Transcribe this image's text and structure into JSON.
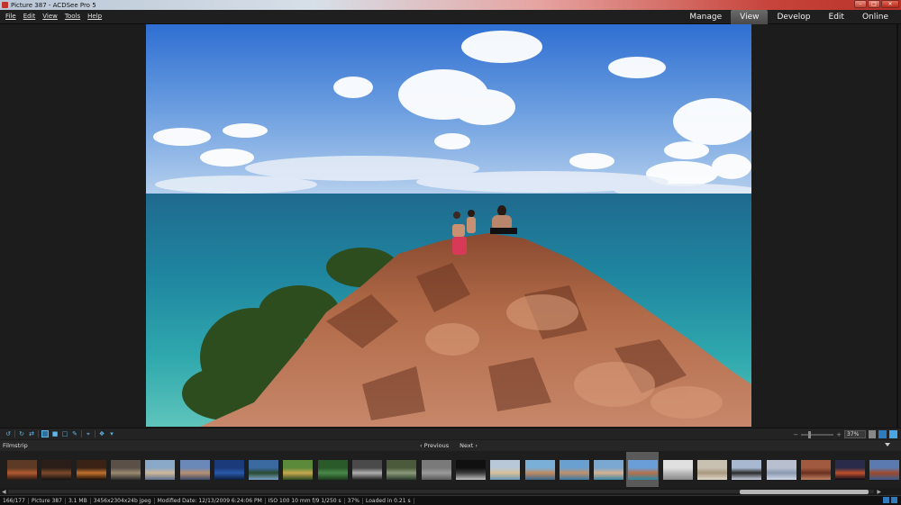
{
  "window": {
    "title": "Picture 387 - ACDSee Pro 5"
  },
  "menu": [
    "File",
    "Edit",
    "View",
    "Tools",
    "Help"
  ],
  "modes": [
    {
      "label": "Manage",
      "active": false
    },
    {
      "label": "View",
      "active": true
    },
    {
      "label": "Develop",
      "active": false
    },
    {
      "label": "Edit",
      "active": false
    },
    {
      "label": "Online",
      "active": false
    }
  ],
  "toolbar": {
    "zoom_value": "37%"
  },
  "filmstrip": {
    "label": "Filmstrip",
    "previous_label": "Previous",
    "next_label": "Next",
    "selected_index": 18,
    "thumbnails": [
      {
        "colors": [
          "#5c3a25",
          "#b25a30",
          "#2a1a12"
        ]
      },
      {
        "colors": [
          "#2b1e18",
          "#7c4a2c",
          "#141010"
        ]
      },
      {
        "colors": [
          "#3a2214",
          "#c0702c",
          "#1a0e08"
        ]
      },
      {
        "colors": [
          "#5a5048",
          "#9a8a70",
          "#2a2a2a"
        ]
      },
      {
        "colors": [
          "#8aa8c8",
          "#d0b898",
          "#5a7090"
        ]
      },
      {
        "colors": [
          "#6a88b8",
          "#b89070",
          "#3a4a6a"
        ]
      },
      {
        "colors": [
          "#1a3a7a",
          "#2a5aa8",
          "#0c1c3c"
        ]
      },
      {
        "colors": [
          "#3a6aa0",
          "#2a4a30",
          "#7aa0c8"
        ]
      },
      {
        "colors": [
          "#5a8a3a",
          "#c8a850",
          "#2a4a20"
        ]
      },
      {
        "colors": [
          "#2a5a2a",
          "#4a8a4a",
          "#1a3a1a"
        ]
      },
      {
        "colors": [
          "#4a4a4a",
          "#b0b0b0",
          "#202020"
        ]
      },
      {
        "colors": [
          "#4a5a3a",
          "#8a9a7a",
          "#2a3a2a"
        ]
      },
      {
        "colors": [
          "#7a7a7a",
          "#9a9a9a",
          "#5a5a5a"
        ]
      },
      {
        "colors": [
          "#101010",
          "#3a3a3a",
          "#c0c0c0"
        ]
      },
      {
        "colors": [
          "#b8c8d8",
          "#d8c098",
          "#6a98b8"
        ]
      },
      {
        "colors": [
          "#7ab0d8",
          "#c08a60",
          "#3a6a90"
        ]
      },
      {
        "colors": [
          "#6aa0d0",
          "#c0906a",
          "#3a7aa8"
        ]
      },
      {
        "colors": [
          "#7aa8d0",
          "#d8b090",
          "#3a88a8"
        ]
      },
      {
        "colors": [
          "#6a9ed8",
          "#b8704a",
          "#2a8aa8"
        ]
      },
      {
        "colors": [
          "#e0e0e0",
          "#b8b8b8",
          "#8a8a8a"
        ]
      },
      {
        "colors": [
          "#c8c0b0",
          "#a89880",
          "#e0d8c8"
        ]
      },
      {
        "colors": [
          "#a8b8d0",
          "#2a2a2a",
          "#c8d0e0"
        ]
      },
      {
        "colors": [
          "#b8c0d0",
          "#8a98b0",
          "#d0d8e8"
        ]
      },
      {
        "colors": [
          "#a05a40",
          "#6a3020",
          "#c08060"
        ]
      },
      {
        "colors": [
          "#2a2a4a",
          "#c0502a",
          "#0a0a1a"
        ]
      },
      {
        "colors": [
          "#5a7ab0",
          "#a04a2a",
          "#3a5a90"
        ]
      }
    ]
  },
  "status": {
    "position": "166/177",
    "filename": "Picture 387",
    "size": "3.1 MB",
    "dimensions": "3456x2304x24b jpeg",
    "modified": "Modified Date: 12/13/2009 6:24:06 PM",
    "exif": "ISO 100   10 mm   f/9   1/250 s",
    "zoom": "37%",
    "load_time": "Loaded in 0.21 s"
  },
  "icons": {
    "toolbar": [
      "rotate-left-icon",
      "rotate-right-icon",
      "flip-icon",
      "fit-icon",
      "stop-icon",
      "select-icon",
      "eyedropper-icon",
      "crop-icon",
      "retouch-icon"
    ]
  }
}
